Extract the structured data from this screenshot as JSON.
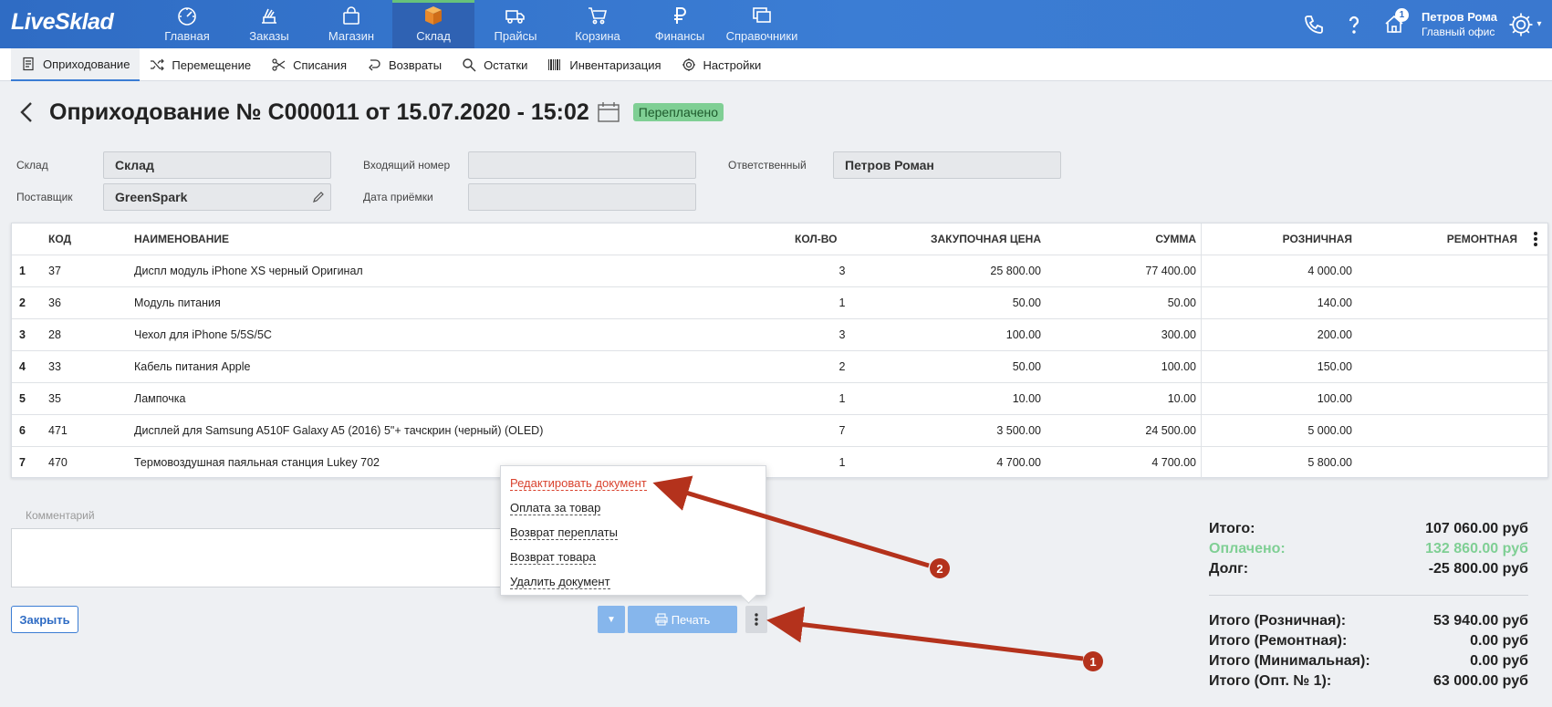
{
  "app": {
    "logo": "LiveSklad",
    "colors": {
      "topbar": "#3b7dd4",
      "accent": "#67c27b",
      "danger": "#d9422e",
      "paid": "#7fcf94"
    }
  },
  "nav": [
    {
      "label": "Главная",
      "icon": "dashboard-icon"
    },
    {
      "label": "Заказы",
      "icon": "orders-icon"
    },
    {
      "label": "Магазин",
      "icon": "shop-icon"
    },
    {
      "label": "Склад",
      "icon": "warehouse-icon",
      "active": true
    },
    {
      "label": "Прайсы",
      "icon": "truck-icon"
    },
    {
      "label": "Корзина",
      "icon": "cart-icon"
    },
    {
      "label": "Финансы",
      "icon": "ruble-icon"
    },
    {
      "label": "Справочники",
      "icon": "reference-icon"
    }
  ],
  "header_right": {
    "notifications_count": "1",
    "user_name": "Петров Рома",
    "user_office": "Главный офис"
  },
  "subnav": [
    {
      "label": "Оприходование",
      "icon": "document-icon",
      "active": true
    },
    {
      "label": "Перемещение",
      "icon": "shuffle-icon"
    },
    {
      "label": "Списания",
      "icon": "scissors-icon"
    },
    {
      "label": "Возвраты",
      "icon": "return-icon"
    },
    {
      "label": "Остатки",
      "icon": "search-icon"
    },
    {
      "label": "Инвентаризация",
      "icon": "barcode-icon"
    },
    {
      "label": "Настройки",
      "icon": "gear-icon"
    }
  ],
  "page": {
    "title": "Оприходование № С000011 от 15.07.2020 - 15:02",
    "status": "Переплачено"
  },
  "form": {
    "warehouse_label": "Склад",
    "warehouse_value": "Склад",
    "supplier_label": "Поставщик",
    "supplier_value": "GreenSpark",
    "incoming_label": "Входящий номер",
    "incoming_value": "",
    "date_label": "Дата приёмки",
    "date_value": "",
    "responsible_label": "Ответственный",
    "responsible_value": "Петров Роман"
  },
  "table": {
    "headers": {
      "code": "КОД",
      "name": "НАИМЕНОВАНИЕ",
      "qty": "КОЛ-ВО",
      "price": "ЗАКУПОЧНАЯ ЦЕНА",
      "sum": "СУММА",
      "retail": "РОЗНИЧНАЯ",
      "repair": "РЕМОНТНАЯ"
    },
    "rows": [
      {
        "num": "1",
        "code": "37",
        "name": "Диспл модуль iPhone XS черный Оригинал",
        "qty": "3",
        "price": "25 800.00",
        "sum": "77 400.00",
        "retail": "4 000.00",
        "repair": ""
      },
      {
        "num": "2",
        "code": "36",
        "name": "Модуль питания",
        "qty": "1",
        "price": "50.00",
        "sum": "50.00",
        "retail": "140.00",
        "repair": ""
      },
      {
        "num": "3",
        "code": "28",
        "name": "Чехол для iPhone 5/5S/5C",
        "qty": "3",
        "price": "100.00",
        "sum": "300.00",
        "retail": "200.00",
        "repair": ""
      },
      {
        "num": "4",
        "code": "33",
        "name": "Кабель питания Apple",
        "qty": "2",
        "price": "50.00",
        "sum": "100.00",
        "retail": "150.00",
        "repair": ""
      },
      {
        "num": "5",
        "code": "35",
        "name": "Лампочка",
        "qty": "1",
        "price": "10.00",
        "sum": "10.00",
        "retail": "100.00",
        "repair": ""
      },
      {
        "num": "6",
        "code": "471",
        "name": "Дисплей для Samsung A510F Galaxy A5 (2016) 5\"+ тачскрин (черный) (OLED)",
        "qty": "7",
        "price": "3 500.00",
        "sum": "24 500.00",
        "retail": "5 000.00",
        "repair": ""
      },
      {
        "num": "7",
        "code": "470",
        "name": "Термовоздушная паяльная станция Lukey 702",
        "qty": "1",
        "price": "4 700.00",
        "sum": "4 700.00",
        "retail": "5 800.00",
        "repair": ""
      }
    ]
  },
  "comment": {
    "label": "Комментарий",
    "value": ""
  },
  "buttons": {
    "close": "Закрыть",
    "print": "Печать"
  },
  "menu": [
    {
      "label": "Редактировать документ",
      "danger": true
    },
    {
      "label": "Оплата за товар"
    },
    {
      "label": "Возврат переплаты"
    },
    {
      "label": "Возврат товара"
    },
    {
      "label": "Удалить документ"
    }
  ],
  "totals": {
    "total_label": "Итого:",
    "total_value": "107 060.00 руб",
    "paid_label": "Оплачено:",
    "paid_value": "132 860.00 руб",
    "debt_label": "Долг:",
    "debt_value": "-25 800.00 руб",
    "retail_label": "Итого (Розничная):",
    "retail_value": "53 940.00 руб",
    "repair_label": "Итого (Ремонтная):",
    "repair_value": "0.00 руб",
    "min_label": "Итого (Минимальная):",
    "min_value": "0.00 руб",
    "opt_label": "Итого (Опт. № 1):",
    "opt_value": "63 000.00 руб"
  },
  "annotations": {
    "marker_1": "1",
    "marker_2": "2"
  }
}
